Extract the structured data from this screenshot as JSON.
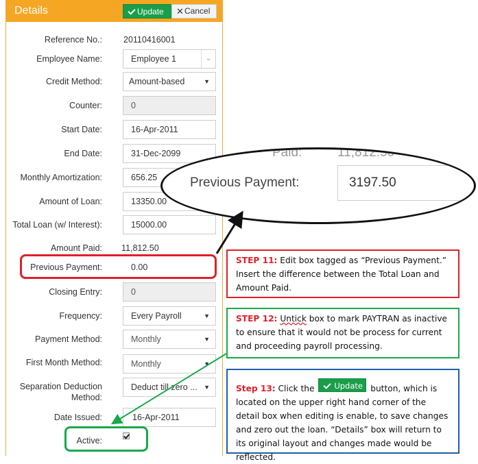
{
  "panel": {
    "title": "Details",
    "update_label": "Update",
    "cancel_label": "Cancel"
  },
  "fields": {
    "reference_no": {
      "label": "Reference No.:",
      "value": "20110416001"
    },
    "employee_name": {
      "label": "Employee Name:",
      "value": "Employee 1"
    },
    "credit_method": {
      "label": "Credit Method:",
      "value": "Amount-based"
    },
    "counter": {
      "label": "Counter:",
      "value": "0"
    },
    "start_date": {
      "label": "Start Date:",
      "value": "16-Apr-2011"
    },
    "end_date": {
      "label": "End Date:",
      "value": "31-Dec-2099"
    },
    "monthly_amortization": {
      "label": "Monthly Amortization:",
      "value": "656.25"
    },
    "amount_of_loan": {
      "label": "Amount of Loan:",
      "value": "13350.00"
    },
    "total_loan": {
      "label": "Total Loan (w/ Interest):",
      "value": "15000.00"
    },
    "amount_paid": {
      "label": "Amount Paid:",
      "value": "11,812.50"
    },
    "previous_payment": {
      "label": "Previous Payment:",
      "value": "0.00"
    },
    "closing_entry": {
      "label": "Closing Entry:",
      "value": "0"
    },
    "frequency": {
      "label": "Frequency:",
      "value": "Every Payroll"
    },
    "payment_method": {
      "label": "Payment Method:",
      "value": "Monthly"
    },
    "first_month_method": {
      "label": "First Month Method:",
      "value": "Monthly"
    },
    "separation_deduction": {
      "label_line1": "Separation Deduction",
      "label_line2": "Method:",
      "value": "Deduct till zero ..."
    },
    "date_issued": {
      "label": "Date Issued:",
      "value": "16-Apr-2011"
    },
    "active": {
      "label": "Active:",
      "checked": true
    }
  },
  "zoom": {
    "label": "Previous Payment:",
    "value": "3197.50",
    "ghost_left": "Paid:",
    "ghost_right": "11,812.50"
  },
  "steps": {
    "step11": {
      "num": "STEP 11:",
      "text": " Edit box tagged as “Previous Payment.” Insert the difference between the Total Loan and Amount Paid."
    },
    "step12": {
      "num": "STEP 12:",
      "underlined": "Untick",
      "text": " box to mark PAYTRAN as inactive to ensure that it would not be process for current and proceeding payroll processing."
    },
    "step13": {
      "num": "Step 13:",
      "before": " Click the ",
      "button": "Update",
      "after": " button, which is located on the upper right hand corner of the detail box when editing is enable, to save changes and zero out the loan. “Details” box will return to its original layout and changes made would be reflected."
    }
  },
  "colors": {
    "header_orange": "#f5a623",
    "update_green": "#1a9e4a",
    "step_red": "#e0202a",
    "step_green": "#18a84a",
    "step_blue": "#1e5fa8"
  }
}
